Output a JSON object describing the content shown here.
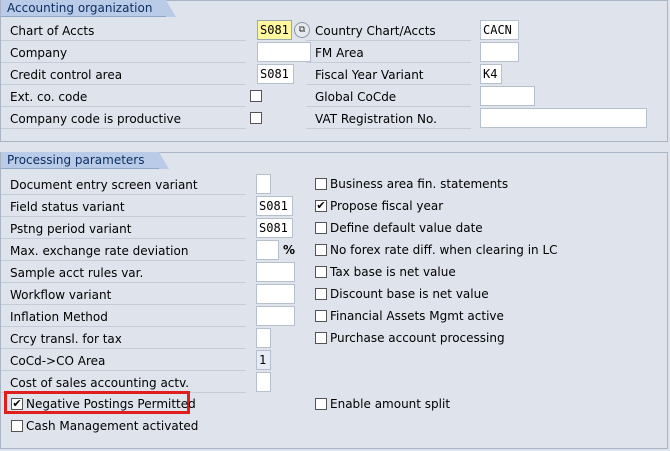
{
  "accounting_org": {
    "title": "Accounting organization",
    "chart_of_accts_label": "Chart of Accts",
    "chart_of_accts_value": "S081",
    "country_chart_label": "Country Chart/Accts",
    "country_chart_value": "CACN",
    "company_label": "Company",
    "company_value": "",
    "fm_area_label": "FM Area",
    "fm_area_value": "",
    "credit_control_label": "Credit control area",
    "credit_control_value": "S081",
    "fiscal_year_variant_label": "Fiscal Year Variant",
    "fiscal_year_variant_value": "K4",
    "ext_co_code_label": "Ext. co. code",
    "ext_co_code_checked": false,
    "global_cocde_label": "Global CoCde",
    "global_cocde_value": "",
    "productive_label": "Company code is productive",
    "productive_checked": false,
    "vat_reg_label": "VAT Registration No.",
    "vat_reg_value": ""
  },
  "processing": {
    "title": "Processing parameters",
    "left": [
      {
        "label": "Document entry screen variant",
        "value": ""
      },
      {
        "label": "Field status variant",
        "value": "S081"
      },
      {
        "label": "Pstng period variant",
        "value": "S081"
      },
      {
        "label": "Max. exchange rate deviation",
        "value": "",
        "unit": "%"
      },
      {
        "label": "Sample acct rules var.",
        "value": ""
      },
      {
        "label": "Workflow variant",
        "value": ""
      },
      {
        "label": "Inflation Method",
        "value": ""
      },
      {
        "label": "Crcy transl. for tax",
        "value": ""
      },
      {
        "label": "CoCd->CO Area",
        "value": "1"
      },
      {
        "label": "Cost of sales accounting actv.",
        "value": ""
      }
    ],
    "right": [
      {
        "label": "Business area fin. statements",
        "checked": false
      },
      {
        "label": "Propose fiscal year",
        "checked": true
      },
      {
        "label": "Define default value date",
        "checked": false
      },
      {
        "label": "No forex rate diff. when clearing in LC",
        "checked": false
      },
      {
        "label": "Tax base is net value",
        "checked": false
      },
      {
        "label": "Discount base is net value",
        "checked": false
      },
      {
        "label": "Financial Assets Mgmt active",
        "checked": false
      },
      {
        "label": "Purchase account processing",
        "checked": false
      }
    ],
    "negative_postings_label": "Negative Postings Permitted",
    "negative_postings_checked": true,
    "enable_amount_split_label": "Enable amount split",
    "enable_amount_split_checked": false,
    "cash_mgmt_label": "Cash Management activated",
    "cash_mgmt_checked": false
  },
  "icons": {
    "f4_help": "value-help-icon",
    "check": "✔"
  },
  "colors": {
    "background": "#dfe4ec",
    "group_title_bg": "#b9cbe6",
    "focus_field": "#fff89e",
    "highlight": "#e01e1e"
  }
}
